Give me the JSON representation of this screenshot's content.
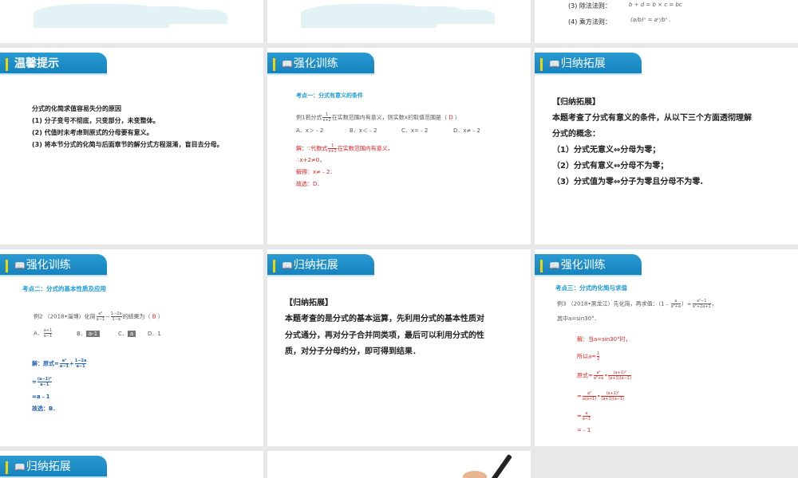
{
  "slides": {
    "s3": {
      "line3": "(3) 除法法则：",
      "line4": "(4) 乘方法则："
    },
    "s4": {
      "tab": "温馨提示",
      "title": "分式的化简求值容易失分的原因",
      "items": [
        "(1) 分子变号不彻底，只变部分，未变整体。",
        "(2) 代值时未考虑到原式的分母要有意义。",
        "(3) 将本节分式的化简与后面章节的解分式方程混淆，盲目去分母。"
      ]
    },
    "s5": {
      "tab": "强化训练",
      "heading": "考点一：分式有意义的条件",
      "q_pre": "例1若分式",
      "q_frac": [
        "1",
        "x+2"
      ],
      "q_post": "在实数范围内有意义，则实数x的取值范围是（",
      "answer": "D",
      "q_end": "）",
      "options": [
        "A．x＞﹣2",
        "B．x＜﹣2",
        "C．x=﹣2",
        "D．x≠﹣2"
      ],
      "sol_pre": "解：∵代数式",
      "sol_post": "在实数范围内有意义，",
      "steps": [
        "∴x+2≠0，",
        "解得：x≠﹣2．",
        "故选：D．"
      ]
    },
    "s6": {
      "tab": "归纳拓展",
      "title": "【归纳拓展】",
      "lines": [
        "本题考查了分式有意义的条件，从以下三个方面透彻理解",
        "分式的概念：",
        "（1）分式无意义⇔分母为零；",
        "（2）分式有意义⇔分母不为零；",
        "（3）分式值为零⇔分子为零且分母不为零."
      ]
    },
    "s7": {
      "tab": "强化训练",
      "heading": "考点二：分式的基本性质及应用",
      "q_pre": "例2 （2018•淄博）化简",
      "f1": [
        "a²",
        "a−1"
      ],
      "minus": "−",
      "f2": [
        "1−2a",
        "1−a"
      ],
      "q_post": "的结果为（",
      "answer": "B",
      "q_end": "）",
      "optA": "A．",
      "optA_frac": [
        "a+1",
        "a−1"
      ],
      "optB": "B．",
      "optB_val": "a-1",
      "optC": "C．",
      "optC_val": "a",
      "optD": "D．1",
      "sol_pre": "解：原式=",
      "s1": [
        "a²",
        "a−1"
      ],
      "plus": "+",
      "s2": [
        "1−2a",
        "a−1"
      ],
      "eq": "=",
      "s3": [
        "(a−1)²",
        "a−1"
      ],
      "step3": "=a﹣1",
      "step4": "故选：B．"
    },
    "s8": {
      "tab": "归纳拓展",
      "title": "【归纳拓展】",
      "lines": [
        "本题考查的是分式的基本运算，先利用分式的基本性质对",
        "分式通分，再对分子合并同类项，最后可以利用分式的性",
        "质，对分子分母约分，即可得到结果．"
      ]
    },
    "s9": {
      "tab": "强化训练",
      "heading": "考点三：分式的化简与求值",
      "q1": "例3 （2018•黑龙江）先化简，再求值：（1﹣",
      "qf1": [
        "a",
        "a²+a"
      ],
      "q_div": "）÷",
      "qf2": [
        "a²−1",
        "a²+2a+1"
      ],
      "q_end": "，",
      "q2": "其中a=sin30°．",
      "sol1": "解：当a=sin30°时，",
      "sol2": "所以a=",
      "half": [
        "1",
        "2"
      ],
      "sol3": "原式=",
      "f3a": [
        "a²",
        "a²+a"
      ],
      "f3b": [
        "(a+1)²",
        "(a+1)(a−1)"
      ],
      "eq": "=",
      "f4a": [
        "a²",
        "a(a+1)"
      ],
      "f4b": [
        "(a+1)²",
        "(a+1)(a−1)"
      ],
      "f5": [
        "a",
        "a−1"
      ],
      "last": "=﹣1"
    },
    "s10": {
      "tab": "归纳拓展"
    }
  }
}
